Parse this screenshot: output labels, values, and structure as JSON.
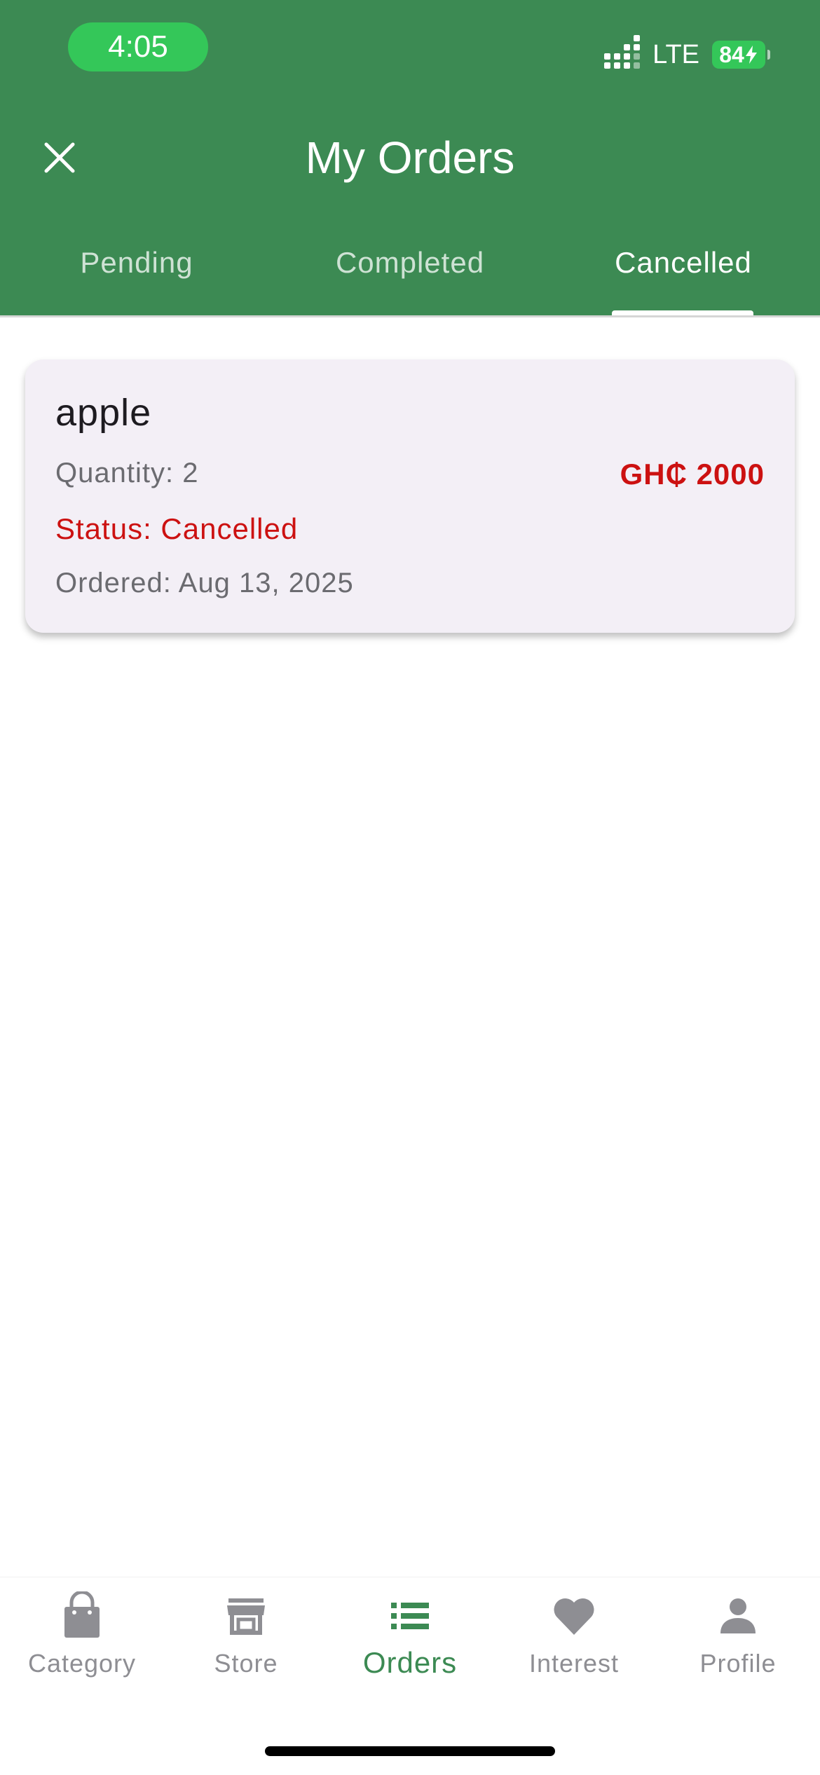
{
  "status_bar": {
    "time": "4:05",
    "network": "LTE",
    "battery": "84"
  },
  "header": {
    "title": "My Orders",
    "close_icon": "close-icon",
    "background_color": "#3c8a53"
  },
  "tabs": [
    {
      "label": "Pending",
      "active": false
    },
    {
      "label": "Completed",
      "active": false
    },
    {
      "label": "Cancelled",
      "active": true
    }
  ],
  "orders": [
    {
      "name": "apple",
      "quantity": "Quantity: 2",
      "price": "GH₵ 2000",
      "status": "Status: Cancelled",
      "ordered": "Ordered: Aug 13, 2025"
    }
  ],
  "bottom_nav": [
    {
      "label": "Category",
      "icon": "shopping-bag-icon",
      "active": false
    },
    {
      "label": "Store",
      "icon": "store-icon",
      "active": false
    },
    {
      "label": "Orders",
      "icon": "list-icon",
      "active": true
    },
    {
      "label": "Interest",
      "icon": "heart-icon",
      "active": false
    },
    {
      "label": "Profile",
      "icon": "person-icon",
      "active": false
    }
  ],
  "colors": {
    "accent": "#3c8a53",
    "status_cancelled": "#cc1111",
    "card_background": "#f3eff6"
  }
}
